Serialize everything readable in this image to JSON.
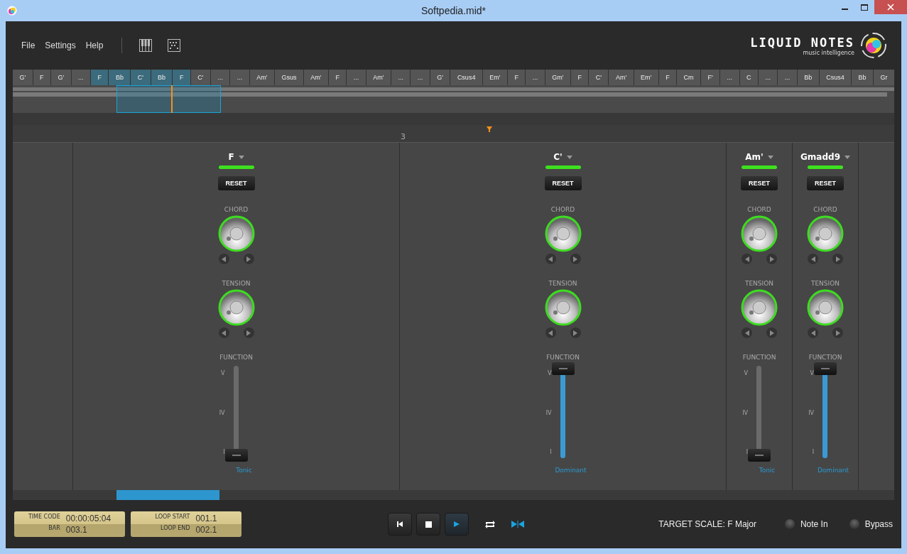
{
  "window": {
    "title": "Softpedia.mid*"
  },
  "menu": [
    "File",
    "Settings",
    "Help"
  ],
  "logo": {
    "name": "LIQUID NOTES",
    "tagline": "music intelligence"
  },
  "chord_strip": [
    {
      "label": "G'",
      "selected": false
    },
    {
      "label": "F",
      "selected": false
    },
    {
      "label": "G'",
      "selected": false
    },
    {
      "label": "...",
      "selected": false
    },
    {
      "label": "F",
      "selected": true
    },
    {
      "label": "Bb",
      "selected": true
    },
    {
      "label": "C'",
      "selected": true
    },
    {
      "label": "Bb",
      "selected": true
    },
    {
      "label": "F",
      "selected": true
    },
    {
      "label": "C'",
      "selected": false
    },
    {
      "label": "...",
      "selected": false
    },
    {
      "label": "...",
      "selected": false
    },
    {
      "label": "Am'",
      "selected": false
    },
    {
      "label": "Gsus",
      "selected": false
    },
    {
      "label": "Am'",
      "selected": false
    },
    {
      "label": "F",
      "selected": false
    },
    {
      "label": "...",
      "selected": false
    },
    {
      "label": "Am'",
      "selected": false
    },
    {
      "label": "...",
      "selected": false
    },
    {
      "label": "...",
      "selected": false
    },
    {
      "label": "G'",
      "selected": false
    },
    {
      "label": "Csus4",
      "selected": false
    },
    {
      "label": "Em'",
      "selected": false
    },
    {
      "label": "F",
      "selected": false
    },
    {
      "label": "...",
      "selected": false
    },
    {
      "label": "Gm'",
      "selected": false
    },
    {
      "label": "F",
      "selected": false
    },
    {
      "label": "C'",
      "selected": false
    },
    {
      "label": "Am'",
      "selected": false
    },
    {
      "label": "Em'",
      "selected": false
    },
    {
      "label": "F",
      "selected": false
    },
    {
      "label": "Cm",
      "selected": false
    },
    {
      "label": "F'",
      "selected": false
    },
    {
      "label": "...",
      "selected": false
    },
    {
      "label": "C",
      "selected": false
    },
    {
      "label": "...",
      "selected": false
    },
    {
      "label": "...",
      "selected": false
    },
    {
      "label": "Bb",
      "selected": false
    },
    {
      "label": "Csus4",
      "selected": false
    },
    {
      "label": "Bb",
      "selected": false
    },
    {
      "label": "Gr",
      "selected": false
    }
  ],
  "ruler": {
    "marker": "3"
  },
  "columns": [
    {
      "chord": "F",
      "reset": "RESET",
      "chord_label": "CHORD",
      "tension_label": "TENSION",
      "function_label": "FUNCTION",
      "ticks": [
        "V",
        "IV",
        "I"
      ],
      "level": 0.03,
      "function": "Tonic",
      "wide": true
    },
    {
      "chord": "C'",
      "reset": "RESET",
      "chord_label": "CHORD",
      "tension_label": "TENSION",
      "function_label": "FUNCTION",
      "ticks": [
        "V",
        "IV",
        "I"
      ],
      "level": 0.97,
      "function": "Dominant",
      "wide": true
    },
    {
      "chord": "Am'",
      "reset": "RESET",
      "chord_label": "CHORD",
      "tension_label": "TENSION",
      "function_label": "FUNCTION",
      "ticks": [
        "V",
        "IV",
        "I"
      ],
      "level": 0.03,
      "function": "Tonic",
      "wide": false
    },
    {
      "chord": "Gmadd9",
      "reset": "RESET",
      "chord_label": "CHORD",
      "tension_label": "TENSION",
      "function_label": "FUNCTION",
      "ticks": [
        "V",
        "IV",
        "I"
      ],
      "level": 0.97,
      "function": "Dominant",
      "wide": false
    }
  ],
  "lcd": [
    {
      "label": "TIME CODE",
      "value": "00:00:05:04"
    },
    {
      "label": "BAR",
      "value": "003.1"
    },
    {
      "label": "LOOP START",
      "value": "001.1"
    },
    {
      "label": "LOOP END",
      "value": "002.1"
    }
  ],
  "transport": [
    {
      "kind": "rewind",
      "selected": false
    },
    {
      "kind": "stop",
      "selected": false
    },
    {
      "kind": "play",
      "selected": true
    }
  ],
  "target_scale": "TARGET SCALE: F Major",
  "toggles": [
    {
      "label": "Note In",
      "on": false
    },
    {
      "label": "Bypass",
      "on": false
    }
  ]
}
